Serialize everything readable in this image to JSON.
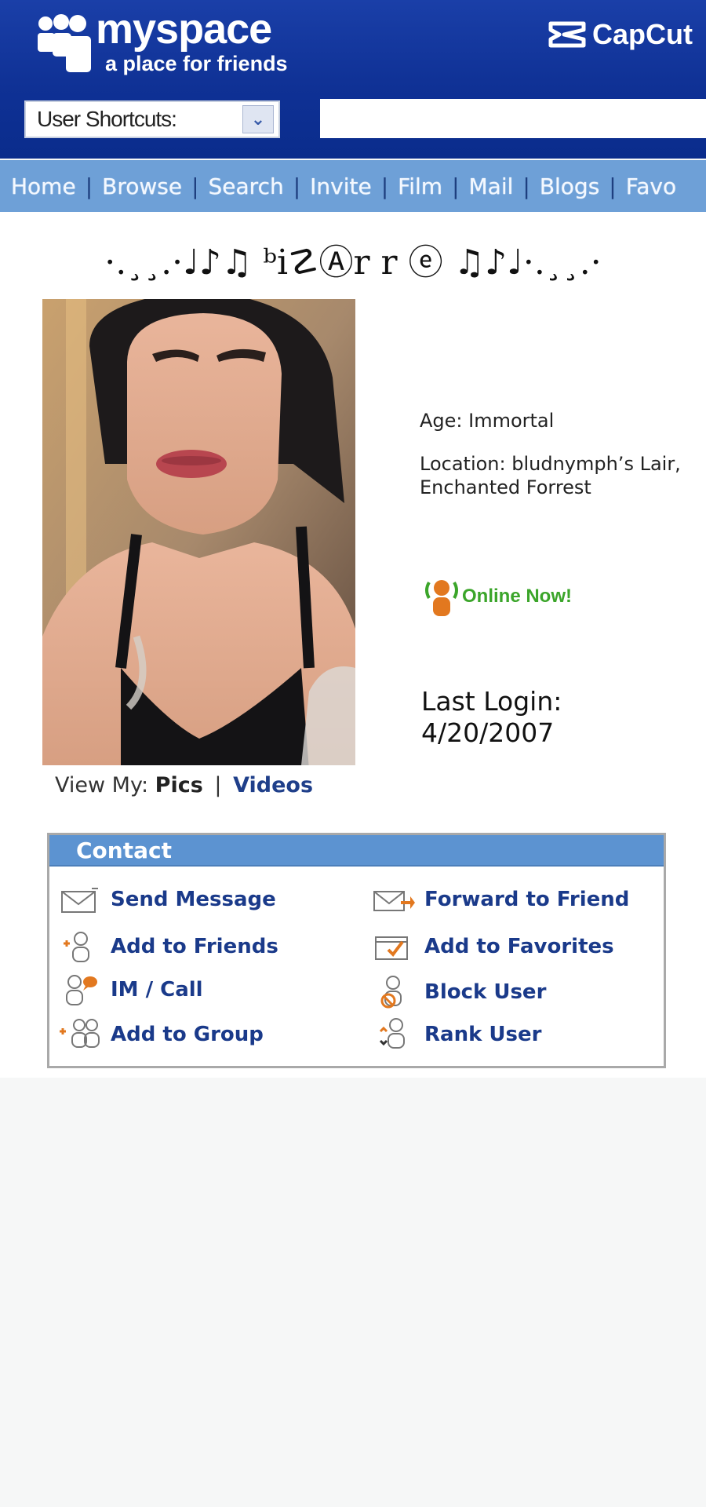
{
  "header": {
    "logo_word": "myspace",
    "logo_tagline": "a place for friends",
    "watermark": "CapCut",
    "shortcuts_label": "User Shortcuts:",
    "search_value": ""
  },
  "nav": {
    "items": [
      {
        "label": "Home"
      },
      {
        "label": "Browse"
      },
      {
        "label": "Search"
      },
      {
        "label": "Invite"
      },
      {
        "label": "Film"
      },
      {
        "label": "Mail"
      },
      {
        "label": "Blogs"
      },
      {
        "label": "Favo"
      }
    ],
    "separator": "|"
  },
  "profile": {
    "display_name": "·.¸¸.·♩♪♫ ᵇi☡Ⓐr r ⓔ ♫♪♩·.¸¸.·",
    "age": "Age: Immortal",
    "location": "Location: bludnymph’s Lair, Enchanted Forrest",
    "online_status": "Online Now!",
    "last_login_label": "Last Login:",
    "last_login_date": "4/20/2007",
    "view_my_label": "View My:",
    "view_my_pics": "Pics",
    "view_my_sep": "|",
    "view_my_videos": "Videos"
  },
  "contact": {
    "title": "Contact",
    "actions": [
      {
        "label": "Send Message",
        "icon": "envelope-icon"
      },
      {
        "label": "Forward to Friend",
        "icon": "forward-envelope-icon"
      },
      {
        "label": "Add to Friends",
        "icon": "add-friend-icon"
      },
      {
        "label": "Add to Favorites",
        "icon": "favorites-icon"
      },
      {
        "label": "IM / Call",
        "icon": "im-call-icon"
      },
      {
        "label": "Block User",
        "icon": "block-user-icon"
      },
      {
        "label": "Add to Group",
        "icon": "add-group-icon"
      },
      {
        "label": "Rank User",
        "icon": "rank-user-icon"
      }
    ]
  },
  "colors": {
    "header_blue": "#0f3195",
    "nav_blue": "#6ea0d7",
    "contact_header": "#5c93d1",
    "link_blue": "#1a3a8a",
    "online_green": "#3ba52a",
    "icon_orange": "#e2781f"
  }
}
